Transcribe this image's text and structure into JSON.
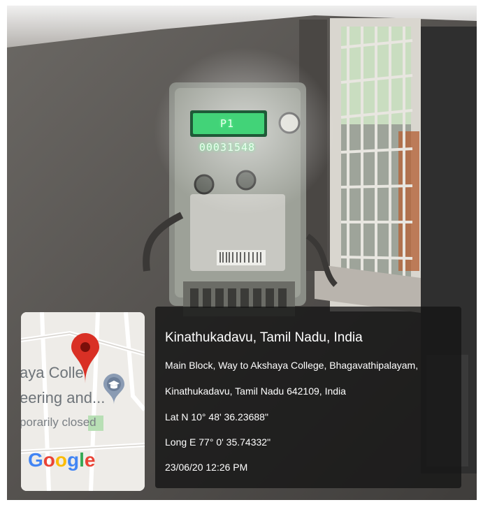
{
  "location": {
    "title": "Kinathukadavu, Tamil Nadu, India",
    "address_line1": "Main Block, Way to Akshaya College, Bhagavathipalayam,",
    "address_line2": "Kinathukadavu, Tamil Nadu 642109, India",
    "latitude": "Lat N 10° 48' 36.23688\"",
    "longitude": "Long E 77° 0' 35.74332\"",
    "timestamp": "23/06/20 12:26 PM"
  },
  "map": {
    "label_line1": "aya Colle",
    "label_line2": "eering and...",
    "label_line3": "porarily closed",
    "brand": "Google",
    "brand_colors": [
      "#4285F4",
      "#EA4335",
      "#FBBC05",
      "#4285F4",
      "#34A853",
      "#EA4335"
    ]
  },
  "meter": {
    "display_reading": "P1 00031548"
  },
  "colors": {
    "pin": "#d93025",
    "display_glow": "#3dff7a",
    "caption_bg": "#141414"
  }
}
